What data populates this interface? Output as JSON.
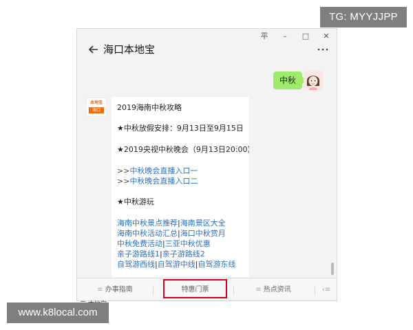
{
  "watermark_top": "TG: MYYJJPP",
  "watermark_bottom": "www.k8local.com",
  "window_controls": {
    "pin": "平",
    "minimize": "–",
    "maximize": "□",
    "close": "✕"
  },
  "chat": {
    "title": "海口本地宝",
    "back_icon": "arrow-left-icon",
    "more_icon": "more-icon",
    "user_message": "中秋",
    "bot_avatar": {
      "top_text": "本地宝",
      "bottom_text": "海口"
    }
  },
  "message": {
    "title": "2019海南中秋攻略",
    "holiday": "★中秋放假安排：9月13日至9月15日",
    "gala": "★2019央视中秋晚会（9月13日20:00）",
    "live_prefix": ">>",
    "live_link_1": "中秋晚会直播入口一",
    "live_link_2": "中秋晚会直播入口二",
    "travel_heading": "★中秋游玩",
    "links": {
      "row1": {
        "a": "海南中秋景点推荐",
        "b": "海南景区大全"
      },
      "row2": {
        "a": "海南中秋活动汇总",
        "b": "海口中秋赏月"
      },
      "row3": {
        "a": "中秋免费活动",
        "b": "三亚中秋优惠"
      },
      "row4": {
        "a": "亲子游路线1",
        "b": "亲子游路线2"
      },
      "row5": {
        "a": "自驾游西线",
        "b": "自驾游中线",
        "c": "自驾游东线"
      }
    },
    "separator": "|"
  },
  "bottom_menu": {
    "item1": "办事指南",
    "item2": "特惠门票",
    "item3": "热点资讯",
    "keyboard_icon": "keyboard-icon",
    "menu_icon": "list-icon"
  },
  "bottom_cut_text": "三 本地宝",
  "colors": {
    "bubble_green": "#9eea6a",
    "link_blue": "#2b70c4",
    "highlight_red": "#d0021b",
    "logo_orange": "#ef6c13"
  }
}
